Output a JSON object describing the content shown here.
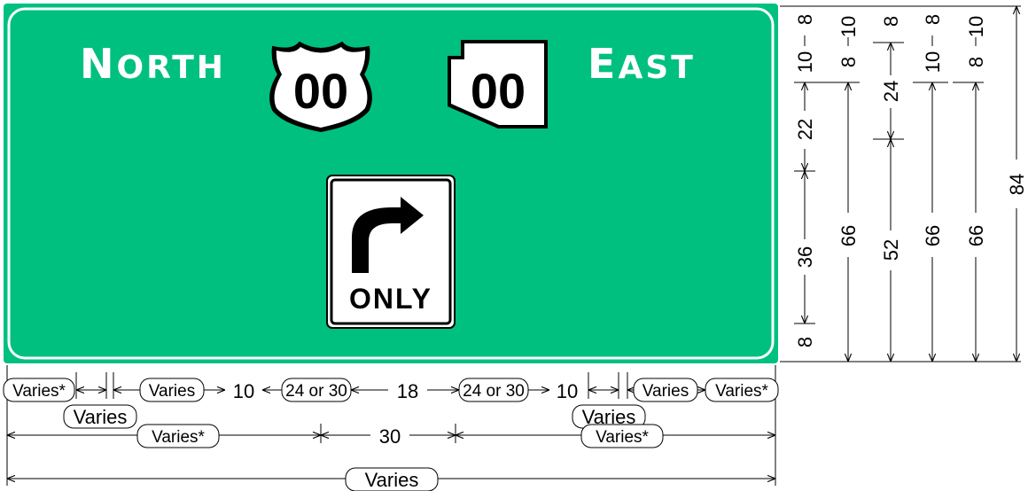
{
  "colors": {
    "sign_green": "#00c080",
    "border": "#ffffff",
    "ink": "#000000"
  },
  "sign": {
    "left_legend": "North",
    "right_legend": "East",
    "us_route_number": "00",
    "state_route_number": "00",
    "lane_sign_text": "ONLY",
    "lane_arrow": "right-turn-arrow-icon"
  },
  "dimensions": {
    "vertical": {
      "col1": [
        "8",
        "10",
        "22",
        "36",
        "8"
      ],
      "col2": [
        "10",
        "8",
        "66"
      ],
      "col3": [
        "8",
        "24",
        "52"
      ],
      "col4": [
        "8",
        "10",
        "66"
      ],
      "col5": [
        "10",
        "8",
        "66"
      ],
      "total": "84"
    },
    "horizontal": {
      "row1": [
        "Varies*",
        "Varies",
        "10",
        "24 or 30",
        "18",
        "24 or 30",
        "10",
        "Varies",
        "Varies*"
      ],
      "row2": [
        "Varies",
        "Varies"
      ],
      "row3": [
        "Varies*",
        "30",
        "Varies*"
      ],
      "row4": [
        "Varies"
      ]
    }
  }
}
